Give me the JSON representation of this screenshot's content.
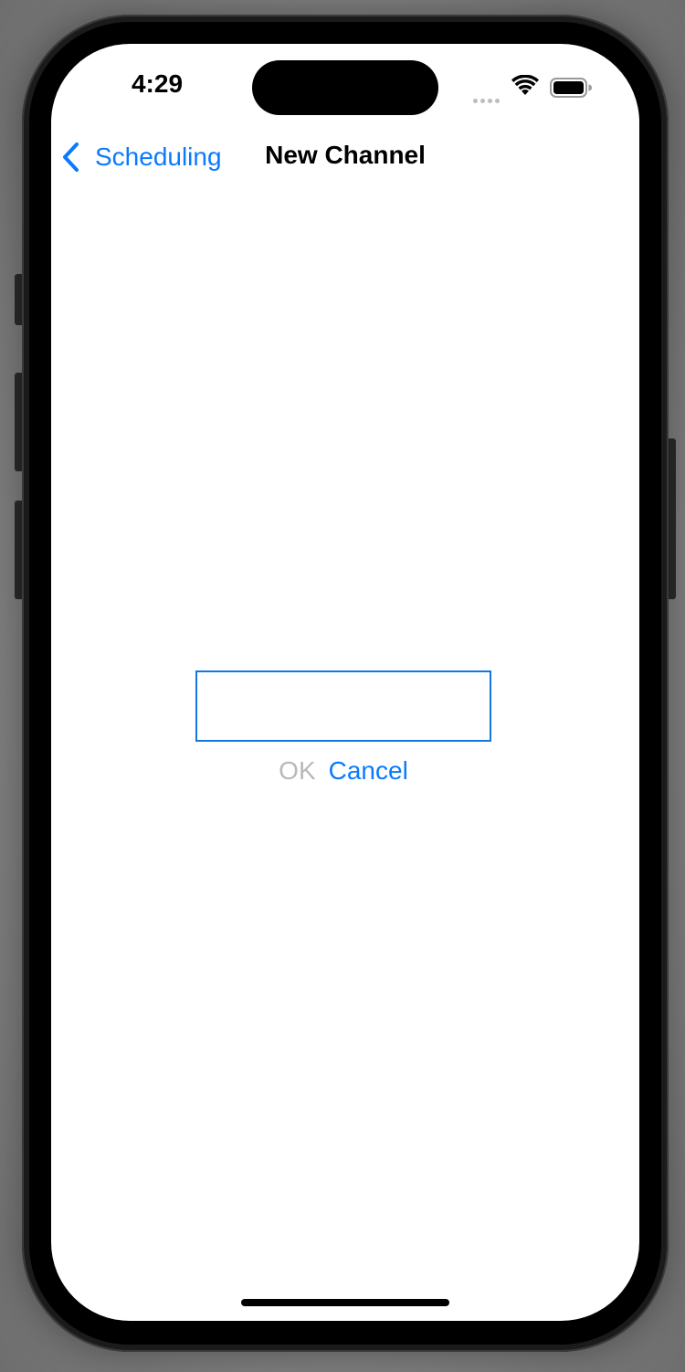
{
  "status_bar": {
    "time": "4:29"
  },
  "nav": {
    "back_label": "Scheduling",
    "title": "New Channel"
  },
  "dialog": {
    "input_value": "",
    "input_placeholder": "",
    "ok_label": "OK",
    "cancel_label": "Cancel"
  },
  "icons": {
    "back": "chevron-left-icon",
    "wifi": "wifi-icon",
    "battery": "battery-icon",
    "signal": "cellular-signal-icon"
  },
  "colors": {
    "accent": "#0a7aff",
    "disabled": "#b9b9b9",
    "field_border": "#1476e6"
  }
}
